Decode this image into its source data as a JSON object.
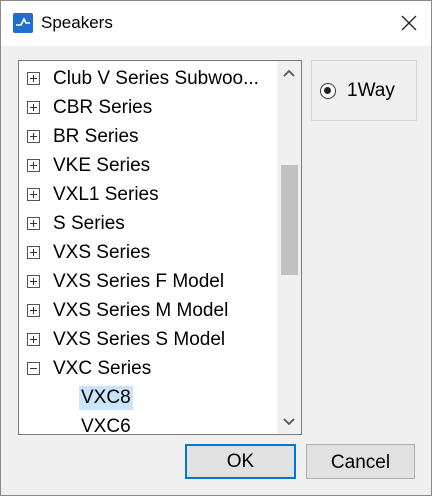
{
  "window": {
    "title": "Speakers"
  },
  "tree": {
    "items": [
      {
        "label": "Club V Series Subwoo...",
        "expander": "plus"
      },
      {
        "label": "CBR Series",
        "expander": "plus"
      },
      {
        "label": "BR Series",
        "expander": "plus"
      },
      {
        "label": "VKE Series",
        "expander": "plus"
      },
      {
        "label": "VXL1 Series",
        "expander": "plus"
      },
      {
        "label": "S Series",
        "expander": "plus"
      },
      {
        "label": "VXS Series",
        "expander": "plus"
      },
      {
        "label": "VXS Series F Model",
        "expander": "plus"
      },
      {
        "label": "VXS Series M Model",
        "expander": "plus"
      },
      {
        "label": "VXS Series S Model",
        "expander": "plus"
      },
      {
        "label": "VXC Series",
        "expander": "minus"
      },
      {
        "label": "VXC8",
        "expander": "none",
        "selected": true
      },
      {
        "label": "VXC6",
        "expander": "none"
      }
    ]
  },
  "options": {
    "radio_label": "1Way",
    "selected": true
  },
  "buttons": {
    "ok": "OK",
    "cancel": "Cancel"
  },
  "colors": {
    "accent": "#0078d7",
    "selection": "#cce4f7",
    "app_icon": "#1f6fd0"
  }
}
